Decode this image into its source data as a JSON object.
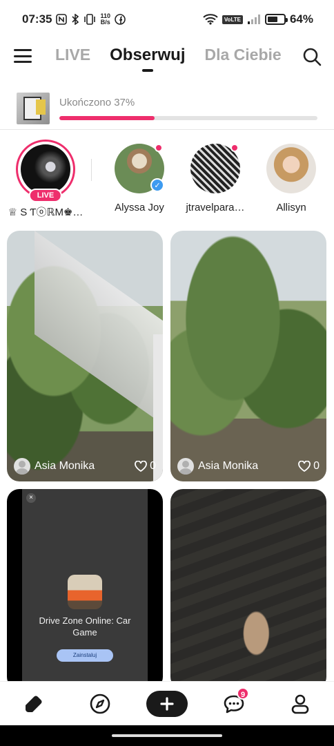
{
  "status_bar": {
    "time": "07:35",
    "speed_top": "110",
    "speed_bottom": "B/s",
    "volte": "VoLTE",
    "battery_level": 0.64,
    "battery_text": "64%"
  },
  "header": {
    "tabs": [
      {
        "label": "LIVE"
      },
      {
        "label": "Obserwuj"
      },
      {
        "label": "Dla Ciebie"
      }
    ],
    "active_tab": "Obserwuj"
  },
  "progress": {
    "label": "Ukończono 37%",
    "value": 0.37,
    "accent": "#ee2e6c"
  },
  "stories": [
    {
      "name": "♕ S ƬⓞℝM♚…",
      "live_label": "LIVE"
    },
    {
      "name": "Alyssa Joy",
      "verified": true,
      "has_new": true
    },
    {
      "name": "jtravelpara…",
      "has_new": true
    },
    {
      "name": "Allisyn"
    }
  ],
  "posts": [
    {
      "user": "Asia Monika",
      "likes": "0"
    },
    {
      "user": "Asia Monika",
      "likes": "0"
    }
  ],
  "ad": {
    "close": "×",
    "title": "Drive Zone Online: Car Game",
    "button": "Zainstaluj"
  },
  "bottom_nav": {
    "messages_badge": "9",
    "add_label": "+"
  },
  "icons": [
    "menu-icon",
    "search-icon",
    "home-icon",
    "compass-icon",
    "plus-icon",
    "chat-icon",
    "profile-icon",
    "heart-icon",
    "verified-icon"
  ]
}
